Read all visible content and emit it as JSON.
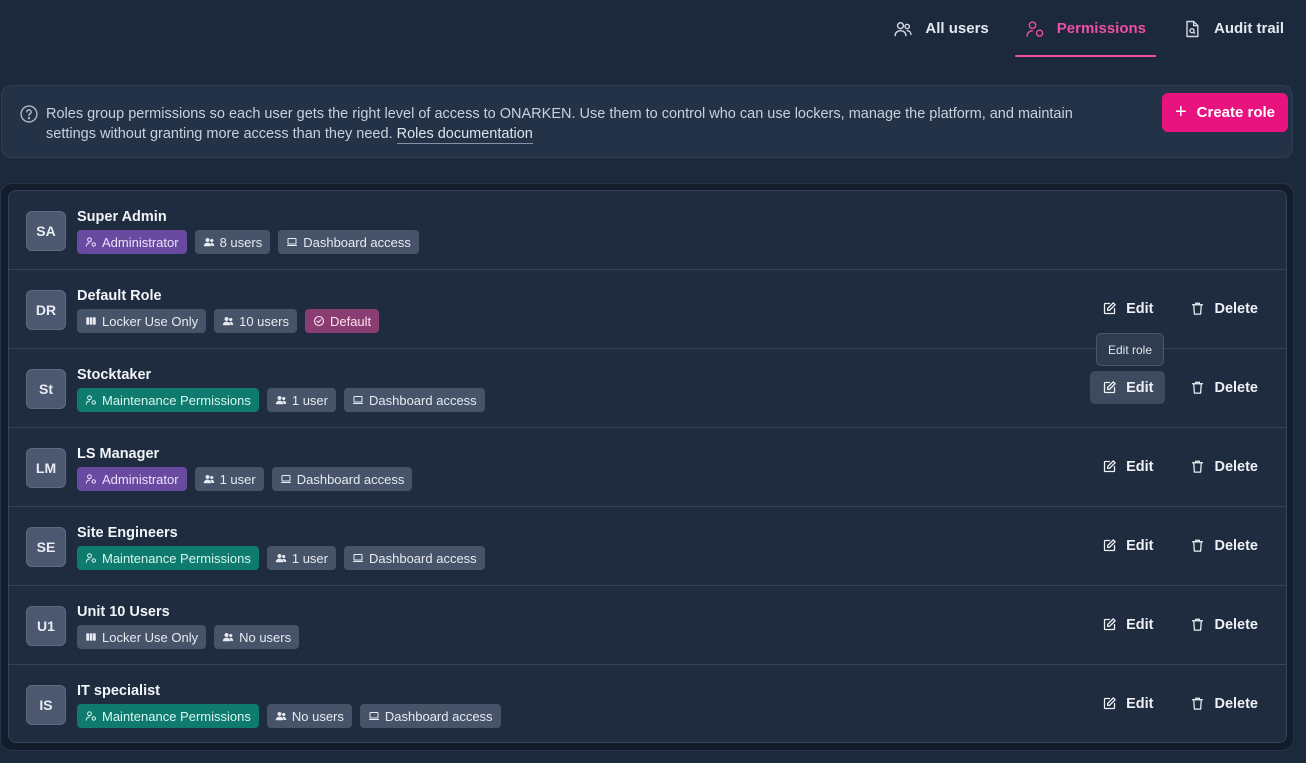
{
  "tabs": [
    {
      "label": "All users",
      "icon": "users-icon",
      "active": false
    },
    {
      "label": "Permissions",
      "icon": "user-shield-icon",
      "active": true
    },
    {
      "label": "Audit trail",
      "icon": "file-search-icon",
      "active": false
    }
  ],
  "banner": {
    "text": "Roles group permissions so each user gets the right level of access to ONARKEN. Use them to control who can use lockers, manage the platform, and maintain settings without granting more access than they need.",
    "link": "Roles documentation",
    "create_label": "Create role",
    "create_plus": "+"
  },
  "tooltip": "Edit role",
  "actions": {
    "edit": "Edit",
    "delete": "Delete"
  },
  "roles": [
    {
      "initials": "SA",
      "name": "Super Admin",
      "badges": [
        {
          "type": "admin",
          "icon": "user-cog-icon",
          "label": "Administrator"
        },
        {
          "type": "count",
          "icon": "users-icon",
          "label": "8 users"
        },
        {
          "type": "access",
          "icon": "laptop-icon",
          "label": "Dashboard access"
        }
      ],
      "editable": false
    },
    {
      "initials": "DR",
      "name": "Default Role",
      "badges": [
        {
          "type": "access",
          "icon": "locker-icon",
          "label": "Locker Use Only"
        },
        {
          "type": "count",
          "icon": "users-icon",
          "label": "10 users"
        },
        {
          "type": "default",
          "icon": "check-circle-icon",
          "label": "Default"
        }
      ],
      "editable": true
    },
    {
      "initials": "St",
      "name": "Stocktaker",
      "badges": [
        {
          "type": "maint",
          "icon": "user-cog-icon",
          "label": "Maintenance Permissions"
        },
        {
          "type": "count",
          "icon": "users-icon",
          "label": "1 user"
        },
        {
          "type": "access",
          "icon": "laptop-icon",
          "label": "Dashboard access"
        }
      ],
      "editable": true,
      "edit_hover": true
    },
    {
      "initials": "LM",
      "name": "LS Manager",
      "badges": [
        {
          "type": "admin",
          "icon": "user-cog-icon",
          "label": "Administrator"
        },
        {
          "type": "count",
          "icon": "users-icon",
          "label": "1 user"
        },
        {
          "type": "access",
          "icon": "laptop-icon",
          "label": "Dashboard access"
        }
      ],
      "editable": true
    },
    {
      "initials": "SE",
      "name": "Site Engineers",
      "badges": [
        {
          "type": "maint",
          "icon": "user-cog-icon",
          "label": "Maintenance Permissions"
        },
        {
          "type": "count",
          "icon": "users-icon",
          "label": "1 user"
        },
        {
          "type": "access",
          "icon": "laptop-icon",
          "label": "Dashboard access"
        }
      ],
      "editable": true
    },
    {
      "initials": "U1",
      "name": "Unit 10 Users",
      "badges": [
        {
          "type": "access",
          "icon": "locker-icon",
          "label": "Locker Use Only"
        },
        {
          "type": "count",
          "icon": "users-icon",
          "label": "No users"
        }
      ],
      "editable": true
    },
    {
      "initials": "IS",
      "name": "IT specialist",
      "badges": [
        {
          "type": "maint",
          "icon": "user-cog-icon",
          "label": "Maintenance Permissions"
        },
        {
          "type": "count",
          "icon": "users-icon",
          "label": "No users"
        },
        {
          "type": "access",
          "icon": "laptop-icon",
          "label": "Dashboard access"
        }
      ],
      "editable": true
    }
  ],
  "colors": {
    "accent": "#e8137f",
    "tab_active": "#ee4fa2",
    "admin_badge": "#6a4aa0",
    "maintenance_badge": "#0f7a6e",
    "default_badge": "#8a3d72"
  }
}
